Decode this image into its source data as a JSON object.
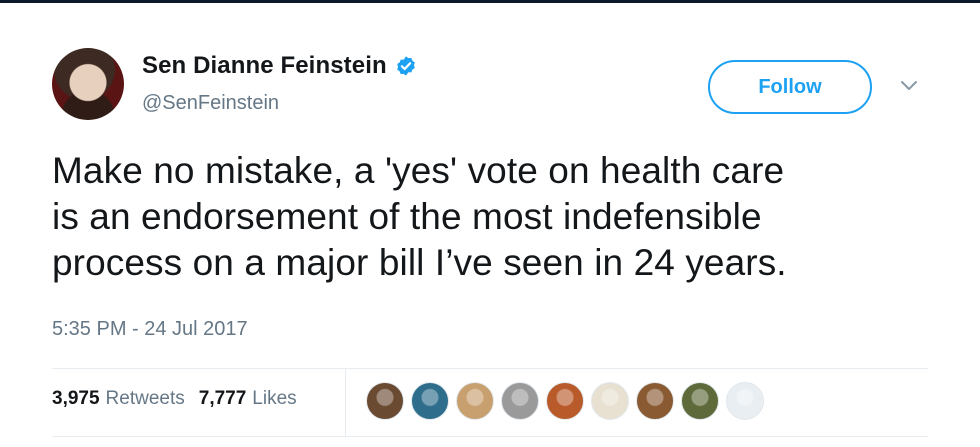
{
  "tweet": {
    "author": {
      "display_name": "Sen Dianne Feinstein",
      "handle": "@SenFeinstein",
      "verified": true
    },
    "follow_label": "Follow",
    "text_lines": [
      "Make no mistake, a 'yes' vote on health care",
      "is an endorsement of the most indefensible",
      "process on a major bill I’ve seen in 24 years."
    ],
    "timestamp": "5:35 PM - 24 Jul 2017",
    "stats": {
      "retweets_count": "3,975",
      "retweets_label": "Retweets",
      "likes_count": "7,777",
      "likes_label": "Likes"
    },
    "liker_avatar_colors": [
      "#6b4a32",
      "#2e6d8c",
      "#c8a070",
      "#9a9a9a",
      "#b85a2a",
      "#e8e0d0",
      "#8a5a32",
      "#5e6a3a",
      "#e8eef2"
    ]
  },
  "colors": {
    "accent": "#1da1f2",
    "text_primary": "#14171a",
    "text_secondary": "#657786",
    "divider": "#e6ecf0"
  },
  "icons": {
    "verified": "verified-badge-icon",
    "menu": "chevron-down-icon"
  }
}
